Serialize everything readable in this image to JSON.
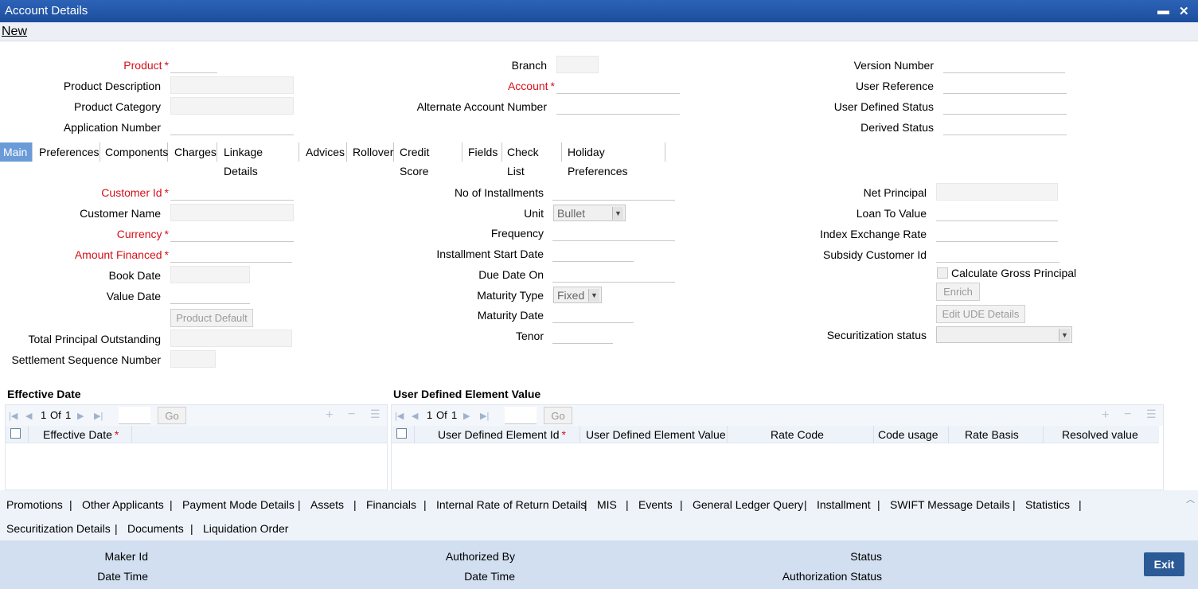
{
  "window": {
    "title": "Account Details",
    "minimize": "▬",
    "close": "✕"
  },
  "menu": {
    "new": "New"
  },
  "header": {
    "product": "Product",
    "product_description": "Product Description",
    "product_category": "Product Category",
    "application_number": "Application Number",
    "branch": "Branch",
    "account": "Account",
    "alternate_account_number": "Alternate Account Number",
    "version_number": "Version Number",
    "user_reference": "User Reference",
    "user_defined_status": "User Defined Status",
    "derived_status": "Derived Status"
  },
  "tabs": [
    "Main",
    "Preferences",
    "Components",
    "Charges",
    "Linkage Details",
    "Advices",
    "Rollover",
    "Credit Score",
    "Fields",
    "Check List",
    "Holiday Preferences"
  ],
  "main": {
    "customer_id": "Customer Id",
    "customer_name": "Customer Name",
    "currency": "Currency",
    "amount_financed": "Amount Financed",
    "book_date": "Book Date",
    "value_date": "Value Date",
    "product_default": "Product Default",
    "total_principal_outstanding": "Total Principal Outstanding",
    "settlement_sequence_number": "Settlement Sequence Number",
    "no_of_installments": "No of Installments",
    "unit": "Unit",
    "unit_value": "Bullet",
    "frequency": "Frequency",
    "installment_start_date": "Installment Start Date",
    "due_date_on": "Due Date On",
    "maturity_type": "Maturity Type",
    "maturity_type_value": "Fixed",
    "maturity_date": "Maturity Date",
    "tenor": "Tenor",
    "net_principal": "Net Principal",
    "loan_to_value": "Loan To Value",
    "index_exchange_rate": "Index Exchange Rate",
    "subsidy_customer_id": "Subsidy Customer Id",
    "calculate_gross_principal": "Calculate Gross Principal",
    "enrich": "Enrich",
    "edit_ude_details": "Edit UDE Details",
    "securitization_status": "Securitization status"
  },
  "effective_date_grid": {
    "title": "Effective Date",
    "page": "1",
    "of": "Of",
    "total": "1",
    "go": "Go",
    "columns": [
      "Effective Date"
    ]
  },
  "ude_grid": {
    "title": "User Defined Element Value",
    "page": "1",
    "of": "Of",
    "total": "1",
    "go": "Go",
    "columns": [
      "User Defined Element Id",
      "User Defined Element Value",
      "Rate Code",
      "Code usage",
      "Rate Basis",
      "Resolved value"
    ]
  },
  "footer_links_row1": [
    "Promotions",
    "Other Applicants",
    "Payment Mode Details",
    "Assets",
    "Financials",
    "Internal Rate of Return Details",
    "MIS",
    "Events",
    "General Ledger Query",
    "Installment",
    "SWIFT Message Details",
    "Statistics"
  ],
  "footer_links_row2": [
    "Securitization Details",
    "Documents",
    "Liquidation Order"
  ],
  "audit": {
    "maker_id": "Maker Id",
    "date_time_1": "Date Time",
    "authorized_by": "Authorized By",
    "date_time_2": "Date Time",
    "status": "Status",
    "authorization_status": "Authorization Status",
    "exit": "Exit"
  },
  "icons": {
    "first": "first-page-icon",
    "prev": "prev-page-icon",
    "next": "next-page-icon",
    "last": "last-page-icon",
    "add": "add-row-icon",
    "delete": "delete-row-icon",
    "view": "single-view-icon"
  }
}
